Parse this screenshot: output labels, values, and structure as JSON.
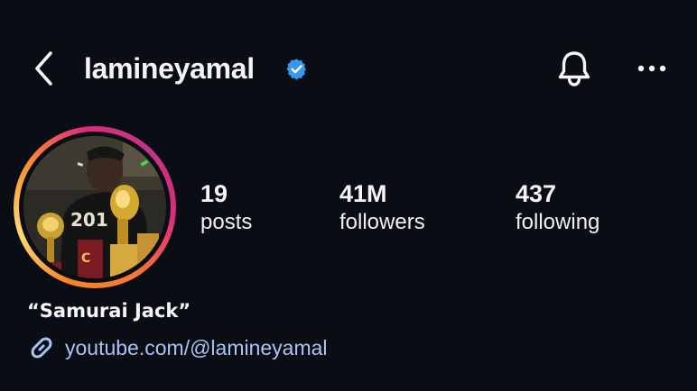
{
  "header": {
    "username": "lamineyamal",
    "back_icon": "chevron-left-icon",
    "verified_icon": "verified-badge-icon",
    "bell_icon": "bell-icon",
    "more_icon": "more-horizontal-icon"
  },
  "profile": {
    "avatar": "profile-photo",
    "stats": [
      {
        "value": "19",
        "label": "posts"
      },
      {
        "value": "41M",
        "label": "followers"
      },
      {
        "value": "437",
        "label": "following"
      }
    ],
    "bio_name": "“Samurai Jack”",
    "link": {
      "icon": "link-icon",
      "text": "youtube.com/@lamineyamal"
    }
  },
  "colors": {
    "background": "#0b0d14",
    "text": "#f5f5f7",
    "verified": "#3897f0",
    "link": "#a9c4f5",
    "ring": [
      "#f58529",
      "#feda75",
      "#dd2a7b",
      "#c13584"
    ]
  }
}
